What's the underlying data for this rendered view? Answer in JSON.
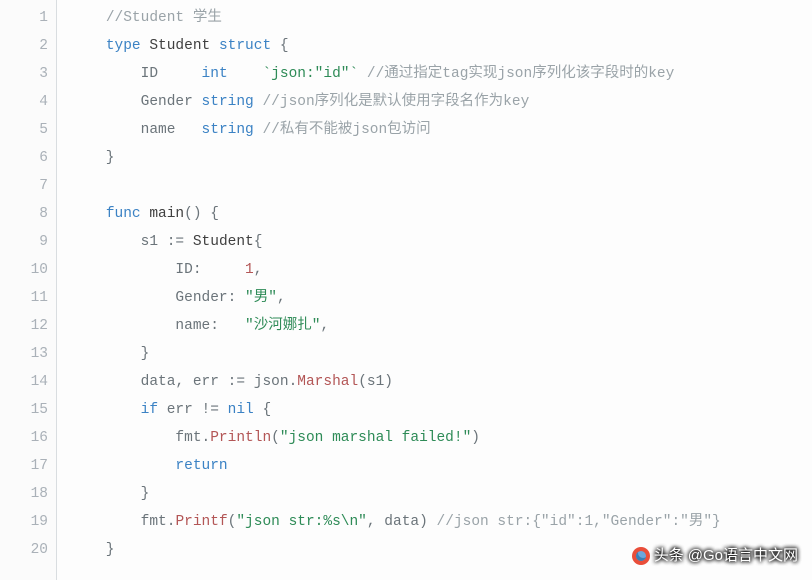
{
  "line_count": 20,
  "lines": [
    [
      {
        "cls": "tok-punct",
        "text": "    "
      },
      {
        "cls": "tok-comment",
        "text": "//Student 学生"
      }
    ],
    [
      {
        "cls": "tok-punct",
        "text": "    "
      },
      {
        "cls": "tok-keyword",
        "text": "type"
      },
      {
        "cls": "tok-punct",
        "text": " "
      },
      {
        "cls": "tok-ident",
        "text": "Student"
      },
      {
        "cls": "tok-punct",
        "text": " "
      },
      {
        "cls": "tok-keyword",
        "text": "struct"
      },
      {
        "cls": "tok-punct",
        "text": " {"
      }
    ],
    [
      {
        "cls": "tok-punct",
        "text": "        "
      },
      {
        "cls": "tok-field",
        "text": "ID"
      },
      {
        "cls": "tok-punct",
        "text": "     "
      },
      {
        "cls": "tok-type",
        "text": "int"
      },
      {
        "cls": "tok-punct",
        "text": "    "
      },
      {
        "cls": "tok-tag",
        "text": "`json:\"id\"`"
      },
      {
        "cls": "tok-punct",
        "text": " "
      },
      {
        "cls": "tok-comment",
        "text": "//通过指定tag实现json序列化该字段时的key"
      }
    ],
    [
      {
        "cls": "tok-punct",
        "text": "        "
      },
      {
        "cls": "tok-field",
        "text": "Gender"
      },
      {
        "cls": "tok-punct",
        "text": " "
      },
      {
        "cls": "tok-type",
        "text": "string"
      },
      {
        "cls": "tok-punct",
        "text": " "
      },
      {
        "cls": "tok-comment",
        "text": "//json序列化是默认使用字段名作为key"
      }
    ],
    [
      {
        "cls": "tok-punct",
        "text": "        "
      },
      {
        "cls": "tok-field",
        "text": "name"
      },
      {
        "cls": "tok-punct",
        "text": "   "
      },
      {
        "cls": "tok-type",
        "text": "string"
      },
      {
        "cls": "tok-punct",
        "text": " "
      },
      {
        "cls": "tok-comment",
        "text": "//私有不能被json包访问"
      }
    ],
    [
      {
        "cls": "tok-punct",
        "text": "    }"
      }
    ],
    [
      {
        "cls": "tok-punct",
        "text": ""
      }
    ],
    [
      {
        "cls": "tok-punct",
        "text": "    "
      },
      {
        "cls": "tok-keyword",
        "text": "func"
      },
      {
        "cls": "tok-punct",
        "text": " "
      },
      {
        "cls": "tok-ident",
        "text": "main"
      },
      {
        "cls": "tok-punct",
        "text": "() {"
      }
    ],
    [
      {
        "cls": "tok-punct",
        "text": "        "
      },
      {
        "cls": "tok-field",
        "text": "s1"
      },
      {
        "cls": "tok-punct",
        "text": " "
      },
      {
        "cls": "tok-op",
        "text": ":="
      },
      {
        "cls": "tok-punct",
        "text": " "
      },
      {
        "cls": "tok-ident",
        "text": "Student"
      },
      {
        "cls": "tok-punct",
        "text": "{"
      }
    ],
    [
      {
        "cls": "tok-punct",
        "text": "            "
      },
      {
        "cls": "tok-field",
        "text": "ID"
      },
      {
        "cls": "tok-punct",
        "text": ":     "
      },
      {
        "cls": "tok-number",
        "text": "1"
      },
      {
        "cls": "tok-punct",
        "text": ","
      }
    ],
    [
      {
        "cls": "tok-punct",
        "text": "            "
      },
      {
        "cls": "tok-field",
        "text": "Gender"
      },
      {
        "cls": "tok-punct",
        "text": ": "
      },
      {
        "cls": "tok-string",
        "text": "\"男\""
      },
      {
        "cls": "tok-punct",
        "text": ","
      }
    ],
    [
      {
        "cls": "tok-punct",
        "text": "            "
      },
      {
        "cls": "tok-field",
        "text": "name"
      },
      {
        "cls": "tok-punct",
        "text": ":   "
      },
      {
        "cls": "tok-string",
        "text": "\"沙河娜扎\""
      },
      {
        "cls": "tok-punct",
        "text": ","
      }
    ],
    [
      {
        "cls": "tok-punct",
        "text": "        }"
      }
    ],
    [
      {
        "cls": "tok-punct",
        "text": "        "
      },
      {
        "cls": "tok-field",
        "text": "data"
      },
      {
        "cls": "tok-punct",
        "text": ", "
      },
      {
        "cls": "tok-field",
        "text": "err"
      },
      {
        "cls": "tok-punct",
        "text": " "
      },
      {
        "cls": "tok-op",
        "text": ":="
      },
      {
        "cls": "tok-punct",
        "text": " "
      },
      {
        "cls": "tok-callpkg",
        "text": "json"
      },
      {
        "cls": "tok-punct",
        "text": "."
      },
      {
        "cls": "tok-callfn",
        "text": "Marshal"
      },
      {
        "cls": "tok-punct",
        "text": "(s1)"
      }
    ],
    [
      {
        "cls": "tok-punct",
        "text": "        "
      },
      {
        "cls": "tok-keyword",
        "text": "if"
      },
      {
        "cls": "tok-punct",
        "text": " "
      },
      {
        "cls": "tok-field",
        "text": "err"
      },
      {
        "cls": "tok-punct",
        "text": " "
      },
      {
        "cls": "tok-op",
        "text": "!="
      },
      {
        "cls": "tok-punct",
        "text": " "
      },
      {
        "cls": "tok-keyword",
        "text": "nil"
      },
      {
        "cls": "tok-punct",
        "text": " {"
      }
    ],
    [
      {
        "cls": "tok-punct",
        "text": "            "
      },
      {
        "cls": "tok-callpkg",
        "text": "fmt"
      },
      {
        "cls": "tok-punct",
        "text": "."
      },
      {
        "cls": "tok-callfn",
        "text": "Println"
      },
      {
        "cls": "tok-punct",
        "text": "("
      },
      {
        "cls": "tok-string",
        "text": "\"json marshal failed!\""
      },
      {
        "cls": "tok-punct",
        "text": ")"
      }
    ],
    [
      {
        "cls": "tok-punct",
        "text": "            "
      },
      {
        "cls": "tok-keyword",
        "text": "return"
      }
    ],
    [
      {
        "cls": "tok-punct",
        "text": "        }"
      }
    ],
    [
      {
        "cls": "tok-punct",
        "text": "        "
      },
      {
        "cls": "tok-callpkg",
        "text": "fmt"
      },
      {
        "cls": "tok-punct",
        "text": "."
      },
      {
        "cls": "tok-callfn",
        "text": "Printf"
      },
      {
        "cls": "tok-punct",
        "text": "("
      },
      {
        "cls": "tok-string",
        "text": "\"json str:%s\\n\""
      },
      {
        "cls": "tok-punct",
        "text": ", data) "
      },
      {
        "cls": "tok-comment",
        "text": "//json str:{\"id\":1,\"Gender\":\"男\"}"
      }
    ],
    [
      {
        "cls": "tok-punct",
        "text": "    }"
      }
    ]
  ],
  "watermark": {
    "prefix": "头条",
    "text": "@Go语言中文网"
  }
}
